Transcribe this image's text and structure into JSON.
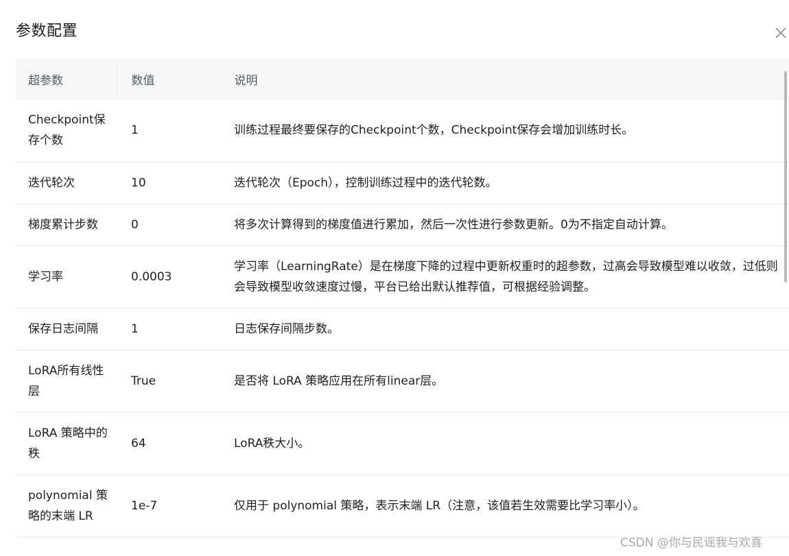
{
  "dialog": {
    "title": "参数配置",
    "close_icon": "close-icon"
  },
  "table": {
    "headers": [
      "超参数",
      "数值",
      "说明"
    ],
    "rows": [
      {
        "param": "Checkpoint保存个数",
        "value": "1",
        "desc": "训练过程最终要保存的Checkpoint个数，Checkpoint保存会增加训练时长。"
      },
      {
        "param": "迭代轮次",
        "value": "10",
        "desc": "迭代轮次（Epoch），控制训练过程中的迭代轮数。"
      },
      {
        "param": "梯度累计步数",
        "value": "0",
        "desc": "将多次计算得到的梯度值进行累加，然后一次性进行参数更新。0为不指定自动计算。"
      },
      {
        "param": "学习率",
        "value": "0.0003",
        "desc": "学习率（LearningRate）是在梯度下降的过程中更新权重时的超参数，过高会导致模型难以收敛，过低则会导致模型收敛速度过慢，平台已给出默认推荐值，可根据经验调整。"
      },
      {
        "param": "保存日志间隔",
        "value": "1",
        "desc": "日志保存间隔步数。"
      },
      {
        "param": "LoRA所有线性层",
        "value": "True",
        "desc": "是否将 LoRA 策略应用在所有linear层。"
      },
      {
        "param": "LoRA 策略中的秩",
        "value": "64",
        "desc": "LoRA秩大小。"
      },
      {
        "param": "polynomial 策略的末端 LR",
        "value": "1e-7",
        "desc": "仅用于 polynomial 策略，表示末端 LR（注意，该值若生效需要比学习率小）。"
      }
    ]
  },
  "watermark": "CSDN @你与民谣我与欢喜"
}
